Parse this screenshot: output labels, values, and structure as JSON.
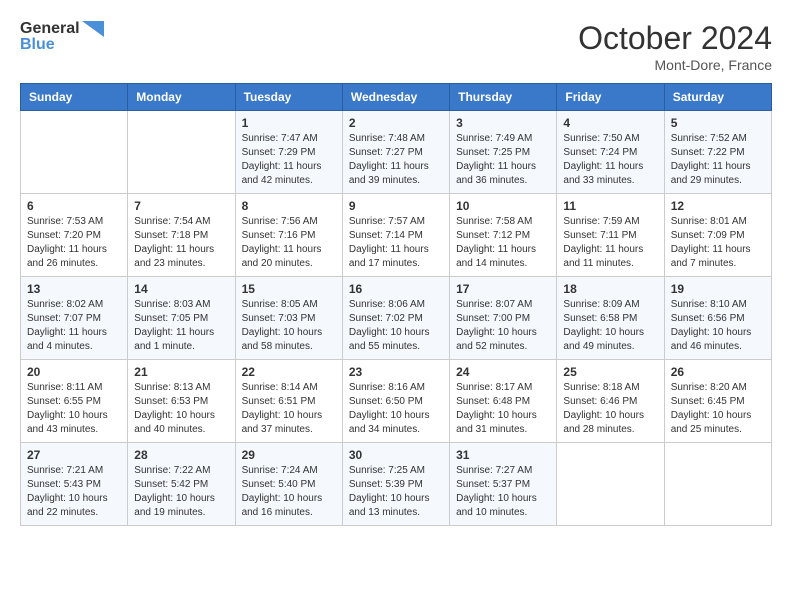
{
  "header": {
    "logo_line1": "General",
    "logo_line2": "Blue",
    "month": "October 2024",
    "location": "Mont-Dore, France"
  },
  "weekdays": [
    "Sunday",
    "Monday",
    "Tuesday",
    "Wednesday",
    "Thursday",
    "Friday",
    "Saturday"
  ],
  "weeks": [
    [
      {
        "day": "",
        "sunrise": "",
        "sunset": "",
        "daylight": ""
      },
      {
        "day": "",
        "sunrise": "",
        "sunset": "",
        "daylight": ""
      },
      {
        "day": "1",
        "sunrise": "Sunrise: 7:47 AM",
        "sunset": "Sunset: 7:29 PM",
        "daylight": "Daylight: 11 hours and 42 minutes."
      },
      {
        "day": "2",
        "sunrise": "Sunrise: 7:48 AM",
        "sunset": "Sunset: 7:27 PM",
        "daylight": "Daylight: 11 hours and 39 minutes."
      },
      {
        "day": "3",
        "sunrise": "Sunrise: 7:49 AM",
        "sunset": "Sunset: 7:25 PM",
        "daylight": "Daylight: 11 hours and 36 minutes."
      },
      {
        "day": "4",
        "sunrise": "Sunrise: 7:50 AM",
        "sunset": "Sunset: 7:24 PM",
        "daylight": "Daylight: 11 hours and 33 minutes."
      },
      {
        "day": "5",
        "sunrise": "Sunrise: 7:52 AM",
        "sunset": "Sunset: 7:22 PM",
        "daylight": "Daylight: 11 hours and 29 minutes."
      }
    ],
    [
      {
        "day": "6",
        "sunrise": "Sunrise: 7:53 AM",
        "sunset": "Sunset: 7:20 PM",
        "daylight": "Daylight: 11 hours and 26 minutes."
      },
      {
        "day": "7",
        "sunrise": "Sunrise: 7:54 AM",
        "sunset": "Sunset: 7:18 PM",
        "daylight": "Daylight: 11 hours and 23 minutes."
      },
      {
        "day": "8",
        "sunrise": "Sunrise: 7:56 AM",
        "sunset": "Sunset: 7:16 PM",
        "daylight": "Daylight: 11 hours and 20 minutes."
      },
      {
        "day": "9",
        "sunrise": "Sunrise: 7:57 AM",
        "sunset": "Sunset: 7:14 PM",
        "daylight": "Daylight: 11 hours and 17 minutes."
      },
      {
        "day": "10",
        "sunrise": "Sunrise: 7:58 AM",
        "sunset": "Sunset: 7:12 PM",
        "daylight": "Daylight: 11 hours and 14 minutes."
      },
      {
        "day": "11",
        "sunrise": "Sunrise: 7:59 AM",
        "sunset": "Sunset: 7:11 PM",
        "daylight": "Daylight: 11 hours and 11 minutes."
      },
      {
        "day": "12",
        "sunrise": "Sunrise: 8:01 AM",
        "sunset": "Sunset: 7:09 PM",
        "daylight": "Daylight: 11 hours and 7 minutes."
      }
    ],
    [
      {
        "day": "13",
        "sunrise": "Sunrise: 8:02 AM",
        "sunset": "Sunset: 7:07 PM",
        "daylight": "Daylight: 11 hours and 4 minutes."
      },
      {
        "day": "14",
        "sunrise": "Sunrise: 8:03 AM",
        "sunset": "Sunset: 7:05 PM",
        "daylight": "Daylight: 11 hours and 1 minute."
      },
      {
        "day": "15",
        "sunrise": "Sunrise: 8:05 AM",
        "sunset": "Sunset: 7:03 PM",
        "daylight": "Daylight: 10 hours and 58 minutes."
      },
      {
        "day": "16",
        "sunrise": "Sunrise: 8:06 AM",
        "sunset": "Sunset: 7:02 PM",
        "daylight": "Daylight: 10 hours and 55 minutes."
      },
      {
        "day": "17",
        "sunrise": "Sunrise: 8:07 AM",
        "sunset": "Sunset: 7:00 PM",
        "daylight": "Daylight: 10 hours and 52 minutes."
      },
      {
        "day": "18",
        "sunrise": "Sunrise: 8:09 AM",
        "sunset": "Sunset: 6:58 PM",
        "daylight": "Daylight: 10 hours and 49 minutes."
      },
      {
        "day": "19",
        "sunrise": "Sunrise: 8:10 AM",
        "sunset": "Sunset: 6:56 PM",
        "daylight": "Daylight: 10 hours and 46 minutes."
      }
    ],
    [
      {
        "day": "20",
        "sunrise": "Sunrise: 8:11 AM",
        "sunset": "Sunset: 6:55 PM",
        "daylight": "Daylight: 10 hours and 43 minutes."
      },
      {
        "day": "21",
        "sunrise": "Sunrise: 8:13 AM",
        "sunset": "Sunset: 6:53 PM",
        "daylight": "Daylight: 10 hours and 40 minutes."
      },
      {
        "day": "22",
        "sunrise": "Sunrise: 8:14 AM",
        "sunset": "Sunset: 6:51 PM",
        "daylight": "Daylight: 10 hours and 37 minutes."
      },
      {
        "day": "23",
        "sunrise": "Sunrise: 8:16 AM",
        "sunset": "Sunset: 6:50 PM",
        "daylight": "Daylight: 10 hours and 34 minutes."
      },
      {
        "day": "24",
        "sunrise": "Sunrise: 8:17 AM",
        "sunset": "Sunset: 6:48 PM",
        "daylight": "Daylight: 10 hours and 31 minutes."
      },
      {
        "day": "25",
        "sunrise": "Sunrise: 8:18 AM",
        "sunset": "Sunset: 6:46 PM",
        "daylight": "Daylight: 10 hours and 28 minutes."
      },
      {
        "day": "26",
        "sunrise": "Sunrise: 8:20 AM",
        "sunset": "Sunset: 6:45 PM",
        "daylight": "Daylight: 10 hours and 25 minutes."
      }
    ],
    [
      {
        "day": "27",
        "sunrise": "Sunrise: 7:21 AM",
        "sunset": "Sunset: 5:43 PM",
        "daylight": "Daylight: 10 hours and 22 minutes."
      },
      {
        "day": "28",
        "sunrise": "Sunrise: 7:22 AM",
        "sunset": "Sunset: 5:42 PM",
        "daylight": "Daylight: 10 hours and 19 minutes."
      },
      {
        "day": "29",
        "sunrise": "Sunrise: 7:24 AM",
        "sunset": "Sunset: 5:40 PM",
        "daylight": "Daylight: 10 hours and 16 minutes."
      },
      {
        "day": "30",
        "sunrise": "Sunrise: 7:25 AM",
        "sunset": "Sunset: 5:39 PM",
        "daylight": "Daylight: 10 hours and 13 minutes."
      },
      {
        "day": "31",
        "sunrise": "Sunrise: 7:27 AM",
        "sunset": "Sunset: 5:37 PM",
        "daylight": "Daylight: 10 hours and 10 minutes."
      },
      {
        "day": "",
        "sunrise": "",
        "sunset": "",
        "daylight": ""
      },
      {
        "day": "",
        "sunrise": "",
        "sunset": "",
        "daylight": ""
      }
    ]
  ]
}
